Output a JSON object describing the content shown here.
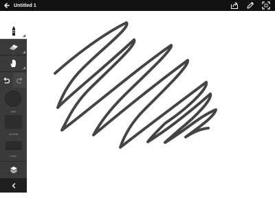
{
  "topbar": {
    "title": "Untitled 1",
    "background": "#111111",
    "back_icon": "arrow-left-icon",
    "actions": [
      "share-icon",
      "pencil-icon",
      "fullscreen-icon"
    ]
  },
  "sidebar": {
    "background": "#3b3b3b",
    "tools": [
      "pen-icon",
      "eraser-icon",
      "hand-icon"
    ],
    "undo_icon": "undo-icon",
    "redo_icon": "redo-icon",
    "size_label": "size",
    "opacity_label": "opacity",
    "color_label": "color",
    "layers_icon": "layers-icon",
    "collapse_icon": "chevron-left-icon"
  },
  "canvas": {
    "background": "#ffffff",
    "stroke_color": "#444444"
  }
}
